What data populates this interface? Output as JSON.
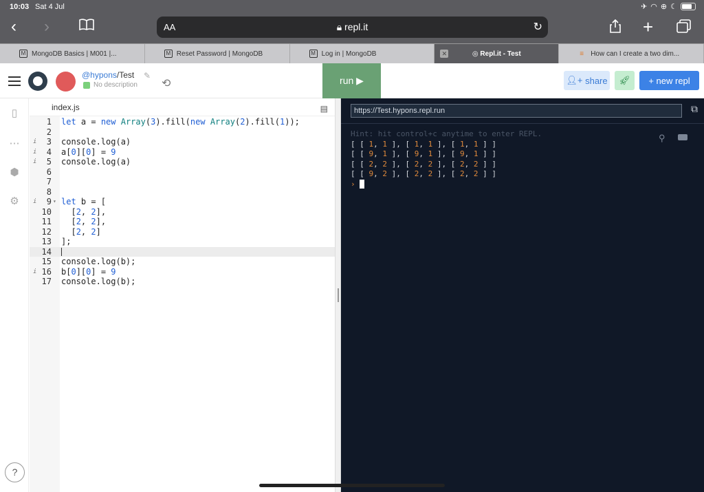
{
  "status": {
    "time": "10:03",
    "date": "Sat 4 Jul"
  },
  "safari": {
    "aa": "AA",
    "url": "repl.it"
  },
  "tabs": [
    {
      "label": "MongoDB Basics | M001 |...",
      "badge": "M"
    },
    {
      "label": "Reset Password | MongoDB",
      "badge": "M"
    },
    {
      "label": "Log in | MongoDB",
      "badge": "M"
    },
    {
      "label": "Repl.it - Test",
      "badge": ""
    },
    {
      "label": "How can I create a two dim...",
      "badge": ""
    }
  ],
  "header": {
    "user_at": "@hypons",
    "user_repl": "/Test",
    "description": "No description",
    "run_label": "run ▶",
    "share_label": "share",
    "new_repl_label": "+ new repl"
  },
  "editor": {
    "filename": "index.js",
    "lines": [
      {
        "n": "1",
        "info": false,
        "code": "let a = new Array(3).fill(new Array(2).fill(1));"
      },
      {
        "n": "2",
        "info": false,
        "code": ""
      },
      {
        "n": "3",
        "info": true,
        "code": "console.log(a)"
      },
      {
        "n": "4",
        "info": true,
        "code": "a[0][0] = 9"
      },
      {
        "n": "5",
        "info": true,
        "code": "console.log(a)"
      },
      {
        "n": "6",
        "info": false,
        "code": ""
      },
      {
        "n": "7",
        "info": false,
        "code": ""
      },
      {
        "n": "8",
        "info": false,
        "code": ""
      },
      {
        "n": "9",
        "info": true,
        "code": "let b = ["
      },
      {
        "n": "10",
        "info": false,
        "code": "  [2, 2],"
      },
      {
        "n": "11",
        "info": false,
        "code": "  [2, 2],"
      },
      {
        "n": "12",
        "info": false,
        "code": "  [2, 2]"
      },
      {
        "n": "13",
        "info": false,
        "code": "];"
      },
      {
        "n": "14",
        "info": false,
        "code": ""
      },
      {
        "n": "15",
        "info": false,
        "code": "console.log(b);"
      },
      {
        "n": "16",
        "info": true,
        "code": "b[0][0] = 9"
      },
      {
        "n": "17",
        "info": false,
        "code": "console.log(b);"
      }
    ]
  },
  "console": {
    "url": "https://Test.hypons.repl.run",
    "hint": "Hint: hit control+c anytime to enter REPL.",
    "output": [
      "[ [ 1, 1 ], [ 1, 1 ], [ 1, 1 ] ]",
      "[ [ 9, 1 ], [ 9, 1 ], [ 9, 1 ] ]",
      "[ [ 2, 2 ], [ 2, 2 ], [ 2, 2 ] ]",
      "[ [ 9, 2 ], [ 2, 2 ], [ 2, 2 ] ]"
    ],
    "prompt": "›"
  },
  "help_label": "?"
}
